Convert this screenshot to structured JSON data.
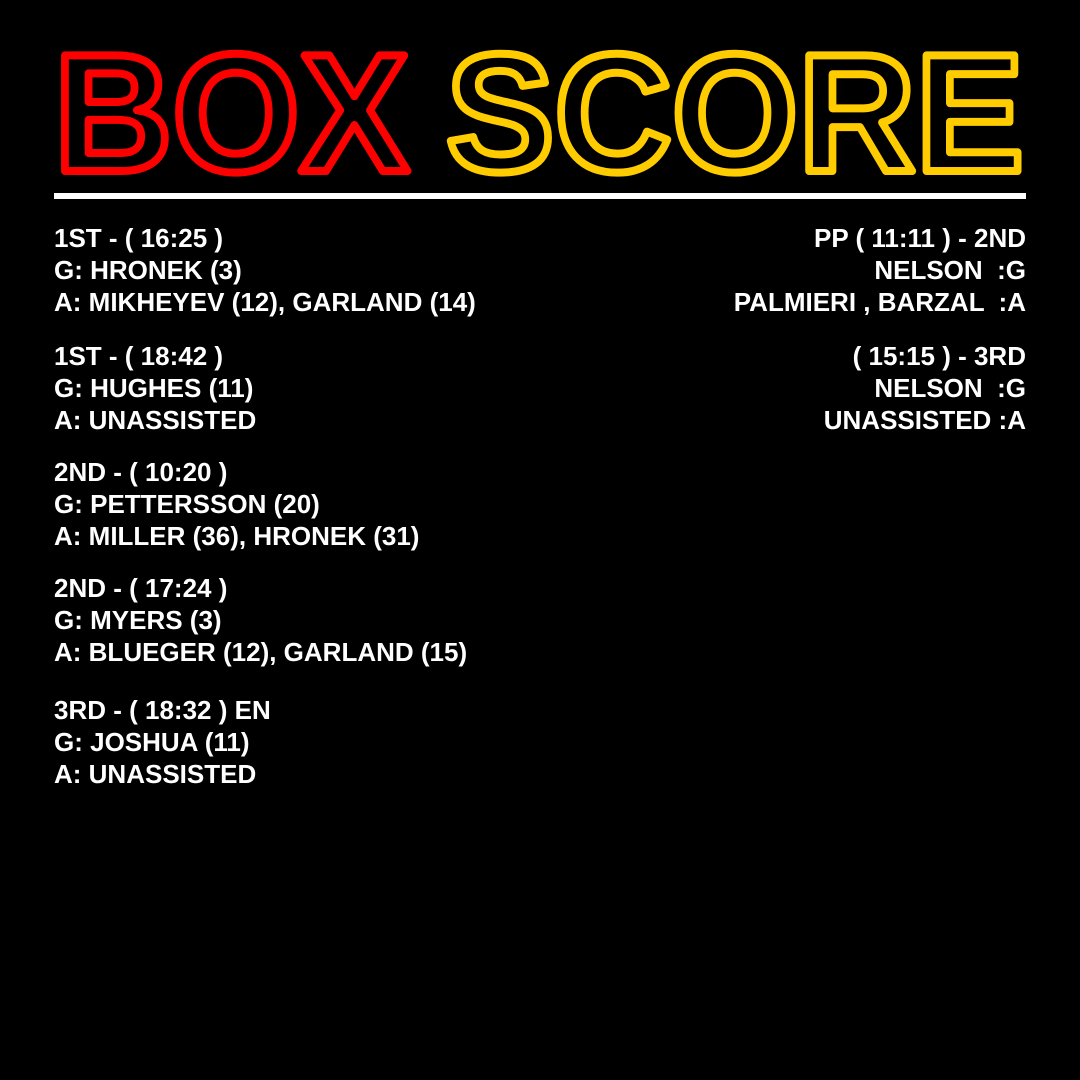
{
  "title": {
    "word1": "BOX",
    "word2": "SCORE",
    "word1_color": "#ff0000",
    "word2_color": "#ffcc00"
  },
  "divider_color": "#ffffff",
  "left_goals": [
    {
      "header": "1ST - ( 16:25 )",
      "goal": "G: HRONEK (3)",
      "assist": "A: MIKHEYEV (12), GARLAND (14)"
    },
    {
      "header": "1ST - ( 18:42 )",
      "goal": "G: HUGHES (11)",
      "assist": "A: UNASSISTED"
    },
    {
      "header": "2ND - ( 10:20 )",
      "goal": "G: PETTERSSON (20)",
      "assist": "A: MILLER (36), HRONEK (31)"
    },
    {
      "header": "2ND - ( 17:24 )",
      "goal": "G: MYERS (3)",
      "assist": "A: BLUEGER (12), GARLAND (15)"
    },
    {
      "header": "3RD - ( 18:32 ) EN",
      "goal": "G: JOSHUA (11)",
      "assist": "A: UNASSISTED"
    }
  ],
  "right_goals": [
    {
      "header": "PP ( 11:11 ) - 2ND",
      "goal": "NELSON  :G",
      "assist": "PALMIERI , BARZAL  :A"
    },
    {
      "header": "( 15:15 ) - 3RD",
      "goal": "NELSON  :G",
      "assist": "UNASSISTED :A"
    }
  ]
}
